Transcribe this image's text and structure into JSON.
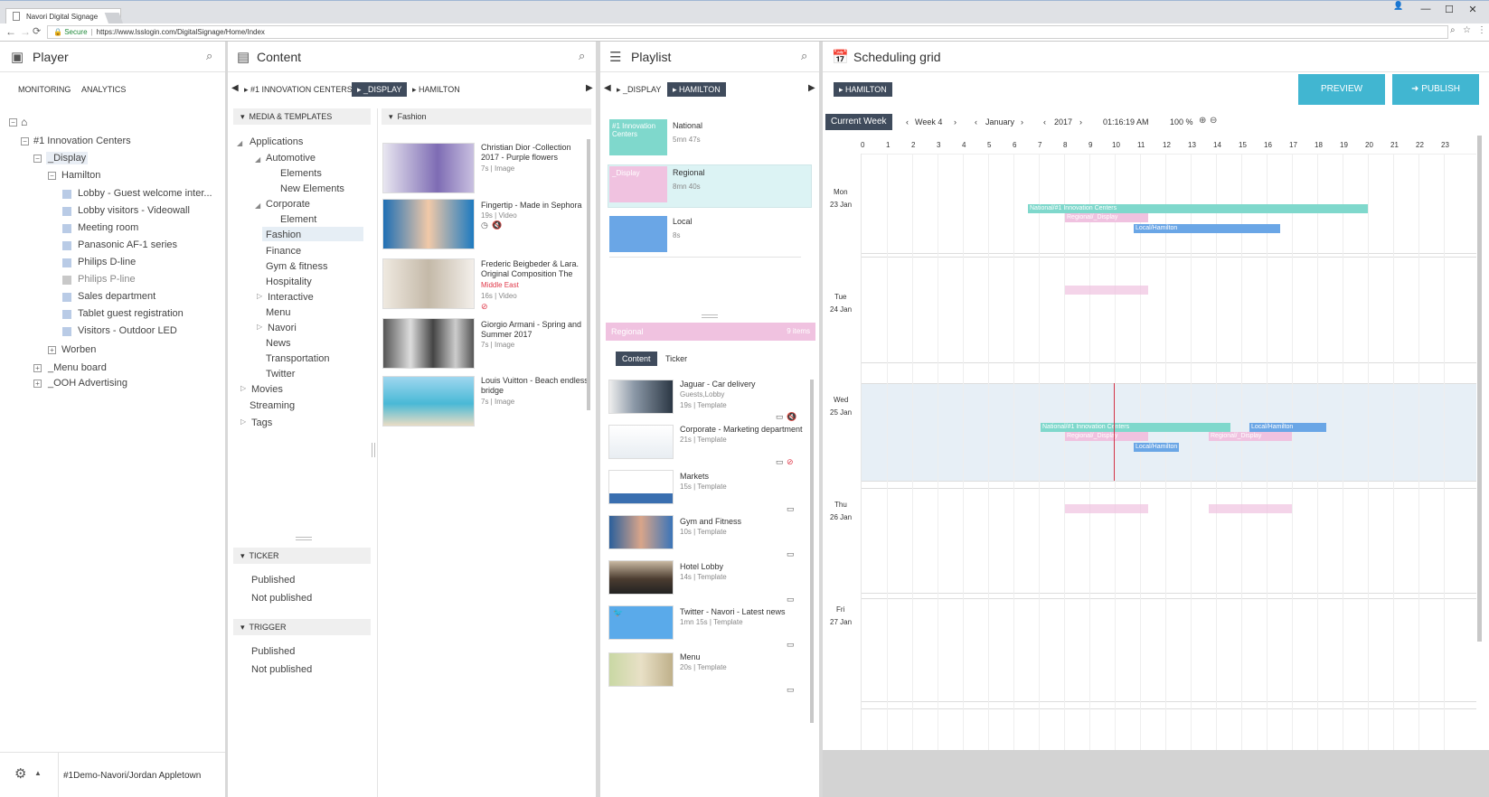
{
  "browser": {
    "tab_title": "Navori Digital Signage",
    "tab_close": "×",
    "secure_label": "Secure",
    "url": "https://www.lsslogin.com/DigitalSignage/Home/Index",
    "win_min": "—",
    "win_max": "☐",
    "win_close": "✕"
  },
  "player": {
    "title": "Player",
    "tabs": [
      "MONITORING",
      "ANALYTICS"
    ],
    "tree": {
      "root": "#1 Innovation Centers",
      "display": "_Display",
      "hamilton": "Hamilton",
      "items": [
        "Lobby - Guest welcome inter...",
        "Lobby visitors - Videowall",
        "Meeting room",
        "Panasonic AF-1 series",
        "Philips D-line",
        "Philips P-line",
        "Sales department",
        "Tablet guest registration",
        "Visitors - Outdoor LED"
      ],
      "worben": "Worben",
      "menu_board": "_Menu board",
      "ooh": "_OOH Advertising"
    },
    "footer_user": "#1Demo-Navori/Jordan Appletown"
  },
  "content": {
    "title": "Content",
    "breadcrumb": [
      "#1 INNOVATION CENTERS",
      "_DISPLAY",
      "HAMILTON"
    ],
    "media_header": "MEDIA & TEMPLATES",
    "tree": {
      "applications": "Applications",
      "automotive": "Automotive",
      "elements": "Elements",
      "new_elements": "New Elements",
      "corporate": "Corporate",
      "element": "Element",
      "fashion": "Fashion",
      "finance": "Finance",
      "gym": "Gym & fitness",
      "hospitality": "Hospitality",
      "interactive": "Interactive",
      "menu": "Menu",
      "navori": "Navori",
      "news": "News",
      "transportation": "Transportation",
      "twitter": "Twitter",
      "movies": "Movies",
      "streaming": "Streaming",
      "tags": "Tags"
    },
    "ticker_header": "TICKER",
    "ticker_items": [
      "Published",
      "Not published"
    ],
    "trigger_header": "TRIGGER",
    "trigger_items": [
      "Published",
      "Not published"
    ],
    "folder_header": "Fashion",
    "media": [
      {
        "title1": "Christian Dior -Collection",
        "title2": "2017 - Purple flowers",
        "dur": "7s",
        "type": "Image"
      },
      {
        "title1": "Fingertip - Made in Sephora",
        "dur": "19s",
        "type": "Video"
      },
      {
        "title1": "Frederic Beigbeder & Lara.",
        "title2": "Original Composition The",
        "tag": "Middle East",
        "dur": "16s",
        "type": "Video"
      },
      {
        "title1": "Giorgio Armani - Spring and",
        "title2": "Summer 2017",
        "dur": "7s",
        "type": "Image"
      },
      {
        "title1": "Louis Vuitton - Beach endless",
        "title2": "bridge",
        "dur": "7s",
        "type": "Image"
      }
    ]
  },
  "playlist": {
    "title": "Playlist",
    "breadcrumb": [
      "_DISPLAY",
      "HAMILTON"
    ],
    "items": [
      {
        "label": "#1 Innovation Centers",
        "name": "National",
        "dur": "5mn 47s",
        "color": "#7fd8cc"
      },
      {
        "label": "_Display",
        "name": "Regional",
        "dur": "8mn 40s",
        "color": "#f0c2e0"
      },
      {
        "label": "",
        "name": "Local",
        "dur": "8s",
        "color": "#6aa6e6"
      }
    ],
    "regional_bar": "Regional",
    "regional_count": "9 items",
    "tabs": [
      "Content",
      "Ticker"
    ],
    "entries": [
      {
        "name": "Jaguar - Car delivery",
        "sub": "Guests,Lobby",
        "dur": "19s",
        "type": "Template"
      },
      {
        "name": "Corporate - Marketing department",
        "dur": "21s",
        "type": "Template"
      },
      {
        "name": "Markets",
        "dur": "15s",
        "type": "Template"
      },
      {
        "name": "Gym and Fitness",
        "dur": "10s",
        "type": "Template"
      },
      {
        "name": "Hotel Lobby",
        "dur": "14s",
        "type": "Template"
      },
      {
        "name": "Twitter - Navori - Latest news",
        "dur": "1mn 15s",
        "type": "Template"
      },
      {
        "name": "Menu",
        "dur": "20s",
        "type": "Template"
      }
    ]
  },
  "scheduling": {
    "title": "Scheduling grid",
    "breadcrumb": "HAMILTON",
    "preview": "PREVIEW",
    "publish": "PUBLISH",
    "current_week": "Current Week",
    "week": "Week 4",
    "month": "January",
    "year": "2017",
    "time": "01:16:19 AM",
    "zoom": "100 %",
    "hours": [
      "0",
      "1",
      "2",
      "3",
      "4",
      "5",
      "6",
      "7",
      "8",
      "9",
      "10",
      "11",
      "12",
      "13",
      "14",
      "15",
      "16",
      "17",
      "18",
      "19",
      "20",
      "21",
      "22",
      "23"
    ],
    "days": [
      {
        "name": "Mon",
        "date": "23 Jan"
      },
      {
        "name": "Tue",
        "date": "24 Jan"
      },
      {
        "name": "Wed",
        "date": "25 Jan"
      },
      {
        "name": "Thu",
        "date": "26 Jan"
      },
      {
        "name": "Fri",
        "date": "27 Jan"
      }
    ],
    "bars": {
      "national": "National/#1 Innovation Centers",
      "regional": "Regional/_Display",
      "local": "Local/Hamilton"
    },
    "colors": {
      "national": "#7fd8cc",
      "regional": "#f0c2e0",
      "local": "#6aa6e6",
      "accent": "#41b6d1",
      "dark": "#3f4b5c"
    }
  }
}
